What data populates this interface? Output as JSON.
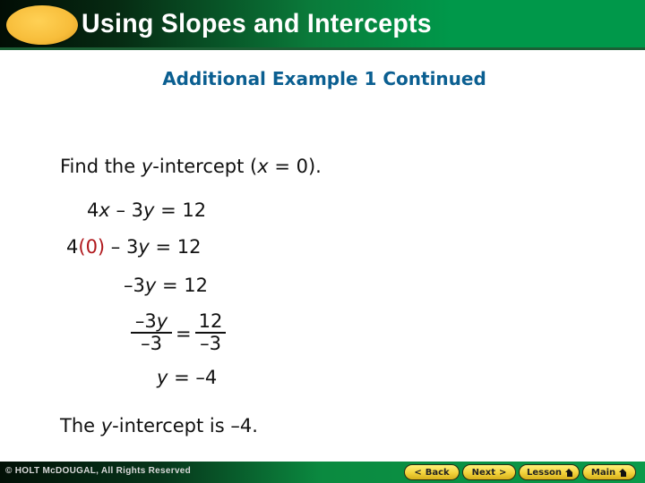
{
  "header": {
    "title": "Using Slopes and Intercepts"
  },
  "subtitle": "Additional Example 1 Continued",
  "content": {
    "instruction": {
      "pre": "Find the ",
      "var": "y",
      "mid": "-intercept (",
      "var2": "x",
      "post": " = 0)."
    },
    "step1": {
      "a": "4",
      "x": "x",
      "b": " – 3",
      "y": "y",
      "c": " = 12"
    },
    "step2": {
      "a": "4",
      "sub": "(0)",
      "b": " – 3",
      "y": "y",
      "c": " = 12"
    },
    "step3": {
      "a": "–3",
      "y": "y",
      "c": " = 12"
    },
    "step4": {
      "left_num": "–3",
      "left_num_var": "y",
      "left_den": "–3",
      "eq": "=",
      "right_num": "12",
      "right_den": "–3"
    },
    "step5": {
      "y": "y",
      "c": " = –4"
    },
    "conclusion": {
      "pre": "The ",
      "var": "y",
      "post": "-intercept is –4."
    }
  },
  "colors": {
    "substitution": "#b0181c",
    "subtitle": "#0b5f91",
    "header_green": "#00984a",
    "button_yellow": "#f2d23a"
  },
  "footer": {
    "copyright": "© HOLT McDOUGAL, All Rights Reserved",
    "nav": {
      "back": {
        "label": "Back",
        "icon": "chevron-left-icon",
        "glyph": "<"
      },
      "next": {
        "label": "Next",
        "icon": "chevron-right-icon",
        "glyph": ">"
      },
      "lesson": {
        "label": "Lesson",
        "icon": "home-icon"
      },
      "main": {
        "label": "Main",
        "icon": "home-icon"
      }
    }
  }
}
